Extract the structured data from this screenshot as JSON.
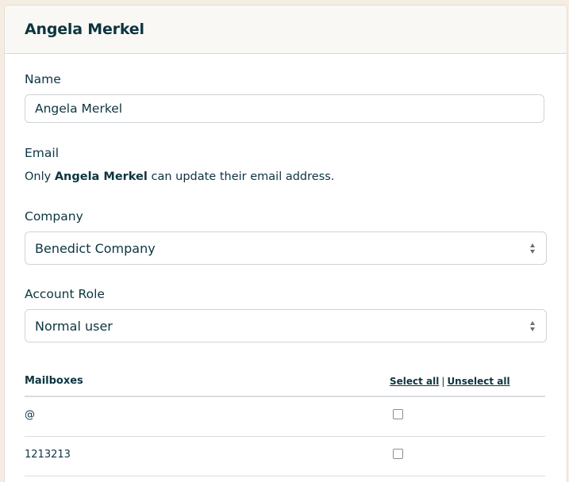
{
  "header": {
    "title": "Angela Merkel"
  },
  "name_field": {
    "label": "Name",
    "value": "Angela Merkel"
  },
  "email_field": {
    "label": "Email",
    "note_prefix": "Only ",
    "note_name": "Angela Merkel",
    "note_suffix": " can update their email address."
  },
  "company_field": {
    "label": "Company",
    "selected": "Benedict Company"
  },
  "role_field": {
    "label": "Account Role",
    "selected": "Normal user"
  },
  "mailboxes": {
    "header": "Mailboxes",
    "select_all": "Select all",
    "separator": "|",
    "unselect_all": "Unselect all",
    "rows": [
      {
        "label": "@",
        "checked": false
      },
      {
        "label": "1213213",
        "checked": false
      }
    ]
  }
}
